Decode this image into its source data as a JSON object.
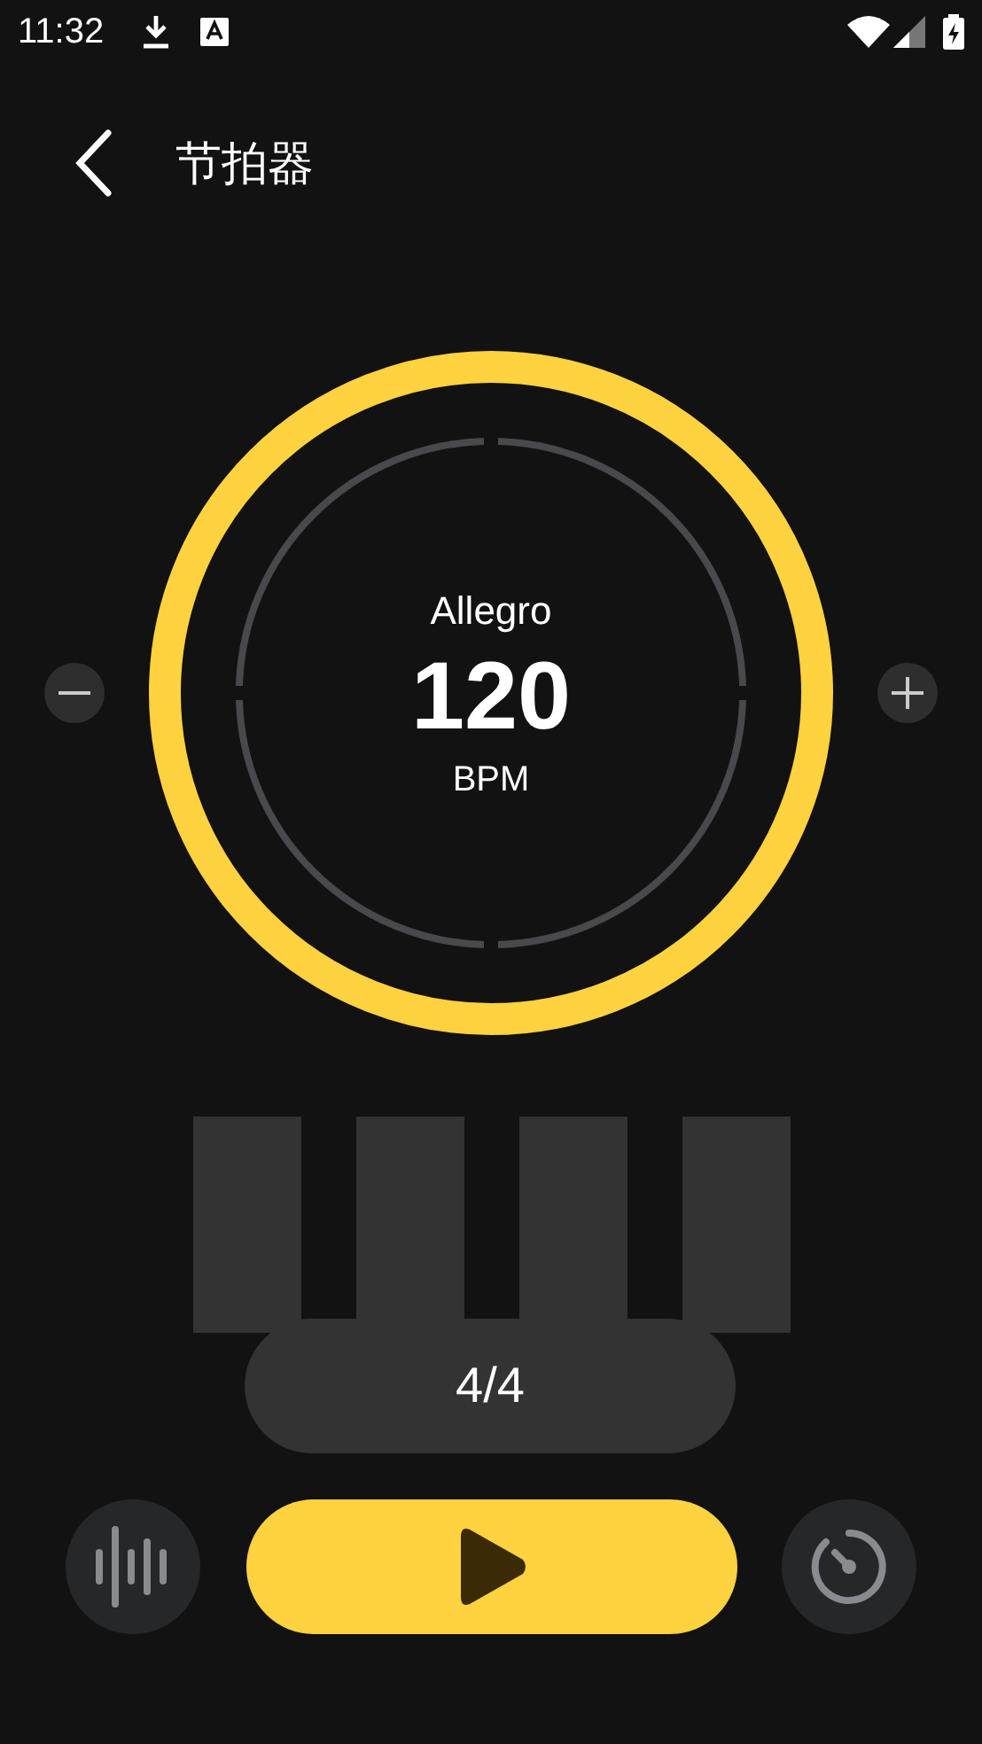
{
  "status_bar": {
    "time": "11:32"
  },
  "header": {
    "title": "节拍器"
  },
  "dial": {
    "tempo_name": "Allegro",
    "bpm": "120",
    "unit": "BPM"
  },
  "time_signature": "4/4"
}
